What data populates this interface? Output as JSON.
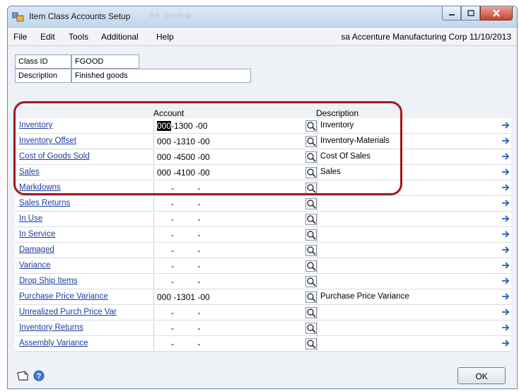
{
  "window": {
    "title": "Item Class Accounts Setup",
    "ghost_title_a": "Sa",
    "ghost_title_b": "Lookup"
  },
  "menu": {
    "items": [
      "File",
      "Edit",
      "Tools",
      "Additional",
      "Help"
    ],
    "status": "sa  Accenture Manufacturing Corp  11/10/2013"
  },
  "header": {
    "class_id_label": "Class ID",
    "class_id_value": "FGOOD",
    "description_label": "Description",
    "description_value": "Finished goods"
  },
  "grid": {
    "account_header": "Account",
    "description_header": "Description",
    "rows": [
      {
        "label": "Inventory",
        "account_seg1": "000",
        "account_rest": "-1300 -00",
        "description": "Inventory",
        "first": true
      },
      {
        "label": "Inventory Offset",
        "account_seg1": "",
        "account_rest": "000 -1310 -00",
        "description": "Inventory-Materials"
      },
      {
        "label": "Cost of Goods Sold",
        "account_seg1": "",
        "account_rest": "000 -4500 -00",
        "description": "Cost Of Sales"
      },
      {
        "label": "Sales",
        "account_seg1": "",
        "account_rest": "000 -4100 -00",
        "description": "Sales"
      },
      {
        "label": "Markdowns",
        "account_seg1": "",
        "account_rest": "      -          -",
        "description": ""
      },
      {
        "label": "Sales Returns",
        "account_seg1": "",
        "account_rest": "      -          -",
        "description": ""
      },
      {
        "label": "In Use",
        "account_seg1": "",
        "account_rest": "      -          -",
        "description": ""
      },
      {
        "label": "In Service",
        "account_seg1": "",
        "account_rest": "      -          -",
        "description": ""
      },
      {
        "label": "Damaged",
        "account_seg1": "",
        "account_rest": "      -          -",
        "description": ""
      },
      {
        "label": "Variance",
        "account_seg1": "",
        "account_rest": "      -          -",
        "description": ""
      },
      {
        "label": "Drop Ship Items",
        "account_seg1": "",
        "account_rest": "      -          -",
        "description": ""
      },
      {
        "label": "Purchase Price Variance",
        "account_seg1": "",
        "account_rest": "000 -1301 -00",
        "description": "Purchase Price Variance"
      },
      {
        "label": "Unrealized Purch Price Var",
        "account_seg1": "",
        "account_rest": "      -          -",
        "description": ""
      },
      {
        "label": "Inventory Returns",
        "account_seg1": "",
        "account_rest": "      -          -",
        "description": ""
      },
      {
        "label": "Assembly Variance",
        "account_seg1": "",
        "account_rest": "      -          -",
        "description": ""
      }
    ]
  },
  "footer": {
    "ok_label": "OK"
  },
  "colors": {
    "link": "#1a3fa0",
    "highlight_ring": "#a31818",
    "arrow": "#1f5fbf"
  },
  "icons": {
    "app": "app-icon",
    "lookup": "magnifier-icon",
    "expand": "right-arrow-icon",
    "note": "note-icon",
    "help": "help-icon"
  }
}
